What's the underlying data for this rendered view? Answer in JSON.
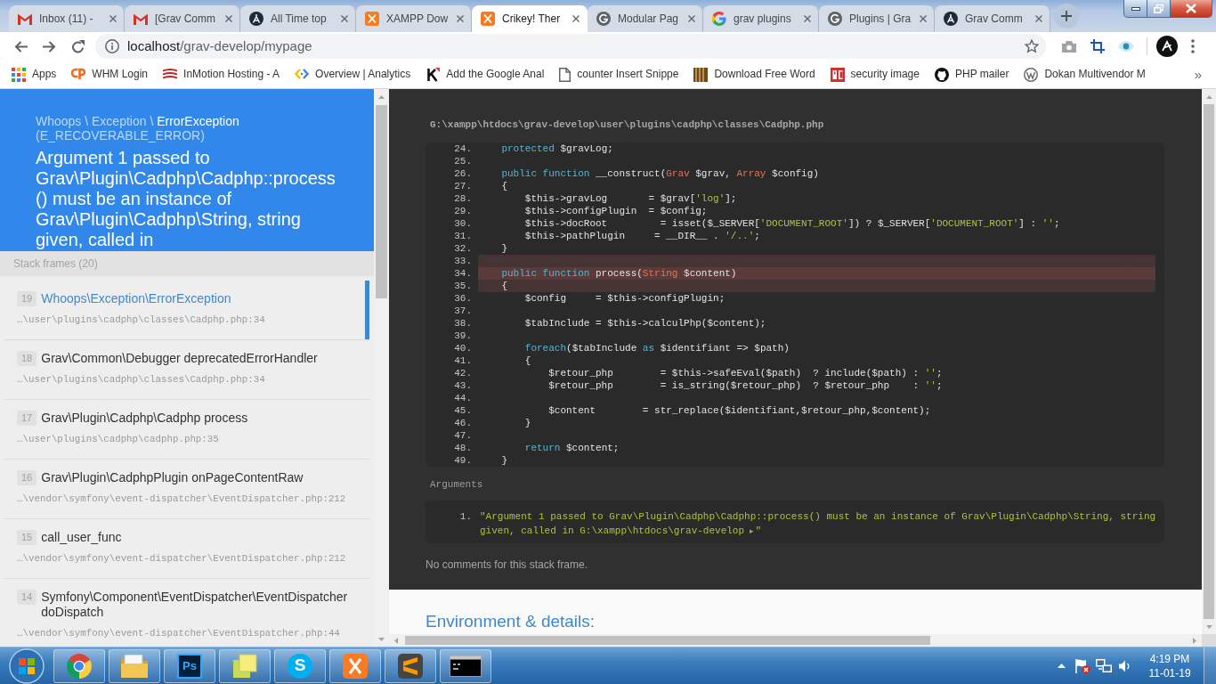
{
  "browser": {
    "tabs": [
      {
        "title": "Inbox (11) -",
        "kind": "mail",
        "selected": false
      },
      {
        "title": "[Grav Comm",
        "kind": "mail",
        "selected": false
      },
      {
        "title": "All Time top",
        "kind": "grav",
        "selected": false
      },
      {
        "title": "XAMPP Dow",
        "kind": "xampp",
        "selected": false
      },
      {
        "title": "Crikey! Ther",
        "kind": "xampp",
        "selected": true
      },
      {
        "title": "Modular Pag",
        "kind": "generic",
        "selected": false
      },
      {
        "title": "grav plugins",
        "kind": "google",
        "selected": false
      },
      {
        "title": "Plugins | Gra",
        "kind": "generic",
        "selected": false
      },
      {
        "title": "Grav Comm",
        "kind": "grav",
        "selected": false
      }
    ],
    "address": {
      "host": "localhost",
      "path": "/grav-develop/mypage"
    },
    "bookmarks": [
      {
        "label": "Apps",
        "kind": "apps"
      },
      {
        "label": "WHM Login",
        "kind": "swoosh"
      },
      {
        "label": "InMotion Hosting - A",
        "kind": "stripes"
      },
      {
        "label": "Overview | Analytics",
        "kind": "chevrons"
      },
      {
        "label": "Add the Google Anal",
        "kind": "k"
      },
      {
        "label": "counter Insert Snippe",
        "kind": "page"
      },
      {
        "label": "Download Free Word",
        "kind": "image"
      },
      {
        "label": "security image",
        "kind": "tile"
      },
      {
        "label": "PHP mailer",
        "kind": "cat"
      },
      {
        "label": "Dokan Multivendor M",
        "kind": "ring"
      }
    ],
    "bookmarks_overflow": "»"
  },
  "error": {
    "exception_namespace": "Whoops \\ Exception \\",
    "exception_name": "ErrorException",
    "error_code": "(E_RECOVERABLE_ERROR)",
    "message": "Argument 1 passed to Grav\\Plugin\\Cadphp\\Cadphp::process() must be an instance of Grav\\Plugin\\Cadphp\\String, string given, called in"
  },
  "stack": {
    "label": "Stack frames (20)",
    "frames": [
      {
        "number": "19",
        "title": "Whoops\\Exception\\ErrorException",
        "path": "…\\user\\plugins\\cadphp\\classes\\Cadphp.php:34",
        "selected": true
      },
      {
        "number": "18",
        "title": "Grav\\Common\\Debugger deprecatedErrorHandler",
        "path": "…\\user\\plugins\\cadphp\\classes\\Cadphp.php:34",
        "selected": false
      },
      {
        "number": "17",
        "title": "Grav\\Plugin\\Cadphp\\Cadphp process",
        "path": "…\\user\\plugins\\cadphp\\cadphp.php:35",
        "selected": false
      },
      {
        "number": "16",
        "title": "Grav\\Plugin\\CadphpPlugin onPageContentRaw",
        "path": "…\\vendor\\symfony\\event-dispatcher\\EventDispatcher.php:212",
        "selected": false
      },
      {
        "number": "15",
        "title": "call_user_func",
        "path": "…\\vendor\\symfony\\event-dispatcher\\EventDispatcher.php:212",
        "selected": false
      },
      {
        "number": "14",
        "title": "Symfony\\Component\\EventDispatcher\\EventDispatcher doDispatch",
        "path": "…\\vendor\\symfony\\event-dispatcher\\EventDispatcher.php:44",
        "selected": false
      }
    ]
  },
  "frame_details": {
    "file_path": "G:\\xampp\\htdocs\\grav-develop\\user\\plugins\\cadphp\\classes\\Cadphp.php",
    "code_lines": [
      {
        "number": "24.",
        "highlighted": false,
        "current": false,
        "tokens": [
          {
            "kind": "keyword",
            "text": "    protected"
          },
          {
            "kind": "plain",
            "text": " $gravLog;"
          }
        ]
      },
      {
        "number": "25.",
        "highlighted": false,
        "current": false
      },
      {
        "number": "26.",
        "highlighted": false,
        "current": false,
        "tokens": [
          {
            "kind": "keyword",
            "text": "    public function"
          },
          {
            "kind": "plain",
            "text": " __construct("
          },
          {
            "kind": "type",
            "text": "Grav"
          },
          {
            "kind": "plain",
            "text": " $grav, "
          },
          {
            "kind": "type",
            "text": "Array"
          },
          {
            "kind": "plain",
            "text": " $config)"
          }
        ]
      },
      {
        "number": "27.",
        "highlighted": false,
        "current": false,
        "tokens": [
          {
            "kind": "plain",
            "text": "    {"
          }
        ]
      },
      {
        "number": "28.",
        "highlighted": false,
        "current": false,
        "tokens": [
          {
            "kind": "plain",
            "text": "        $this->gravLog       = $grav["
          },
          {
            "kind": "string",
            "text": "'log'"
          },
          {
            "kind": "plain",
            "text": "];"
          }
        ]
      },
      {
        "number": "29.",
        "highlighted": false,
        "current": false,
        "tokens": [
          {
            "kind": "plain",
            "text": "        $this->configPlugin  = $config;"
          }
        ]
      },
      {
        "number": "30.",
        "highlighted": false,
        "current": false,
        "tokens": [
          {
            "kind": "plain",
            "text": "        $this->docRoot         = isset($_SERVER["
          },
          {
            "kind": "string",
            "text": "'DOCUMENT_ROOT'"
          },
          {
            "kind": "plain",
            "text": "]) ? $_SERVER["
          },
          {
            "kind": "string",
            "text": "'DOCUMENT_ROOT'"
          },
          {
            "kind": "plain",
            "text": "] : "
          },
          {
            "kind": "string",
            "text": "''"
          },
          {
            "kind": "plain",
            "text": ";"
          }
        ]
      },
      {
        "number": "31.",
        "highlighted": false,
        "current": false,
        "tokens": [
          {
            "kind": "plain",
            "text": "        $this->pathPlugin     = __DIR__ . "
          },
          {
            "kind": "string",
            "text": "'/..'"
          },
          {
            "kind": "plain",
            "text": ";"
          }
        ]
      },
      {
        "number": "32.",
        "highlighted": false,
        "current": false,
        "tokens": [
          {
            "kind": "plain",
            "text": "    }"
          }
        ]
      },
      {
        "number": "33.",
        "highlighted": true,
        "current": false
      },
      {
        "number": "34.",
        "highlighted": true,
        "current": true,
        "tokens": [
          {
            "kind": "keyword",
            "text": "    public function"
          },
          {
            "kind": "plain",
            "text": " process("
          },
          {
            "kind": "type",
            "text": "String"
          },
          {
            "kind": "plain",
            "text": " $content)"
          }
        ]
      },
      {
        "number": "35.",
        "highlighted": true,
        "current": false,
        "tokens": [
          {
            "kind": "plain",
            "text": "    {"
          }
        ]
      },
      {
        "number": "36.",
        "highlighted": false,
        "current": false,
        "tokens": [
          {
            "kind": "plain",
            "text": "        $config     = $this->configPlugin;"
          }
        ]
      },
      {
        "number": "37.",
        "highlighted": false,
        "current": false
      },
      {
        "number": "38.",
        "highlighted": false,
        "current": false,
        "tokens": [
          {
            "kind": "plain",
            "text": "        $tabInclude = $this->calculPhp($content);"
          }
        ]
      },
      {
        "number": "39.",
        "highlighted": false,
        "current": false
      },
      {
        "number": "40.",
        "highlighted": false,
        "current": false,
        "tokens": [
          {
            "kind": "keyword",
            "text": "        foreach"
          },
          {
            "kind": "plain",
            "text": "($tabInclude "
          },
          {
            "kind": "keyword",
            "text": "as"
          },
          {
            "kind": "plain",
            "text": " $identifiant => $path)"
          }
        ]
      },
      {
        "number": "41.",
        "highlighted": false,
        "current": false,
        "tokens": [
          {
            "kind": "plain",
            "text": "        {"
          }
        ]
      },
      {
        "number": "42.",
        "highlighted": false,
        "current": false,
        "tokens": [
          {
            "kind": "plain",
            "text": "            $retour_php        = $this->safeEval($path)  ? include($path) : "
          },
          {
            "kind": "string",
            "text": "''"
          },
          {
            "kind": "plain",
            "text": ";"
          }
        ]
      },
      {
        "number": "43.",
        "highlighted": false,
        "current": false,
        "tokens": [
          {
            "kind": "plain",
            "text": "            $retour_php        = is_string($retour_php)  ? $retour_php    : "
          },
          {
            "kind": "string",
            "text": "''"
          },
          {
            "kind": "plain",
            "text": ";"
          }
        ]
      },
      {
        "number": "44.",
        "highlighted": false,
        "current": false
      },
      {
        "number": "45.",
        "highlighted": false,
        "current": false,
        "tokens": [
          {
            "kind": "plain",
            "text": "            $content        = str_replace($identifiant,$retour_php,$content);"
          }
        ]
      },
      {
        "number": "46.",
        "highlighted": false,
        "current": false,
        "tokens": [
          {
            "kind": "plain",
            "text": "        }"
          }
        ]
      },
      {
        "number": "47.",
        "highlighted": false,
        "current": false
      },
      {
        "number": "48.",
        "highlighted": false,
        "current": false,
        "tokens": [
          {
            "kind": "keyword",
            "text": "        return"
          },
          {
            "kind": "plain",
            "text": " $content;"
          }
        ]
      },
      {
        "number": "49.",
        "highlighted": false,
        "current": false,
        "tokens": [
          {
            "kind": "plain",
            "text": "    }"
          }
        ]
      }
    ],
    "arguments_label": "Arguments",
    "arguments": [
      {
        "number": "1.",
        "value": "\"Argument 1 passed to Grav\\Plugin\\Cadphp\\Cadphp::process() must be an instance of Grav\\Plugin\\Cadphp\\String, string given, called in G:\\xampp\\htdocs\\grav-develop",
        "toggle": "▸",
        "closing": "\""
      }
    ],
    "comments": "No comments for this stack frame."
  },
  "environment_heading": "Environment & details:",
  "taskbar": {
    "apps": [
      {
        "kind": "browser"
      },
      {
        "kind": "folder"
      },
      {
        "kind": "design",
        "glyph": "Ps"
      },
      {
        "kind": "notes"
      },
      {
        "kind": "chat",
        "glyph": "S"
      },
      {
        "kind": "server"
      },
      {
        "kind": "editor"
      },
      {
        "kind": "terminal"
      }
    ],
    "clock": {
      "time": "4:19 PM",
      "date": "11-01-19"
    }
  }
}
